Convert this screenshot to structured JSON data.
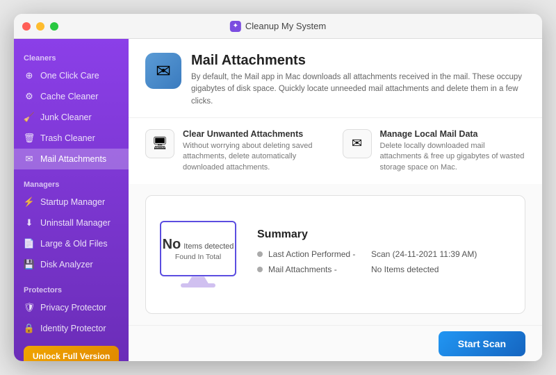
{
  "window": {
    "title": "Cleanup My System",
    "traffic_lights": [
      "red",
      "yellow",
      "green"
    ]
  },
  "sidebar": {
    "cleaners_label": "Cleaners",
    "managers_label": "Managers",
    "protectors_label": "Protectors",
    "items_cleaners": [
      {
        "id": "one-click-care",
        "label": "One Click Care",
        "icon": "⊕"
      },
      {
        "id": "cache-cleaner",
        "label": "Cache Cleaner",
        "icon": "⚙"
      },
      {
        "id": "junk-cleaner",
        "label": "Junk Cleaner",
        "icon": "🧹"
      },
      {
        "id": "trash-cleaner",
        "label": "Trash Cleaner",
        "icon": "🗑"
      },
      {
        "id": "mail-attachments",
        "label": "Mail Attachments",
        "icon": "✉",
        "active": true
      }
    ],
    "items_managers": [
      {
        "id": "startup-manager",
        "label": "Startup Manager",
        "icon": "⚡"
      },
      {
        "id": "uninstall-manager",
        "label": "Uninstall Manager",
        "icon": "⬇"
      },
      {
        "id": "large-old-files",
        "label": "Large & Old Files",
        "icon": "📄"
      },
      {
        "id": "disk-analyzer",
        "label": "Disk Analyzer",
        "icon": "💾"
      }
    ],
    "items_protectors": [
      {
        "id": "privacy-protector",
        "label": "Privacy Protector",
        "icon": "🛡"
      },
      {
        "id": "identity-protector",
        "label": "Identity Protector",
        "icon": "🔒"
      }
    ],
    "unlock_label": "Unlock Full Version"
  },
  "header": {
    "title": "Mail Attachments",
    "description": "By default, the Mail app in Mac downloads all attachments received in the mail. These occupy gigabytes of disk space. Quickly locate unneeded mail attachments and delete them in a few clicks.",
    "icon": "✉"
  },
  "features": [
    {
      "id": "clear-unwanted",
      "title": "Clear Unwanted Attachments",
      "description": "Without worrying about deleting saved attachments, delete automatically downloaded attachments.",
      "icon": "🖥"
    },
    {
      "id": "manage-local",
      "title": "Manage Local Mail Data",
      "description": "Delete locally downloaded mail attachments & free up gigabytes of wasted storage space on Mac.",
      "icon": "✉"
    }
  ],
  "summary": {
    "title": "Summary",
    "monitor_no": "No",
    "monitor_items": "Items detected",
    "monitor_found": "Found In Total",
    "rows": [
      {
        "label": "Last Action Performed -",
        "value": "Scan (24-11-2021 11:39 AM)"
      },
      {
        "label": "Mail Attachments -",
        "value": "No Items detected"
      }
    ]
  },
  "bottom": {
    "start_scan_label": "Start Scan"
  }
}
